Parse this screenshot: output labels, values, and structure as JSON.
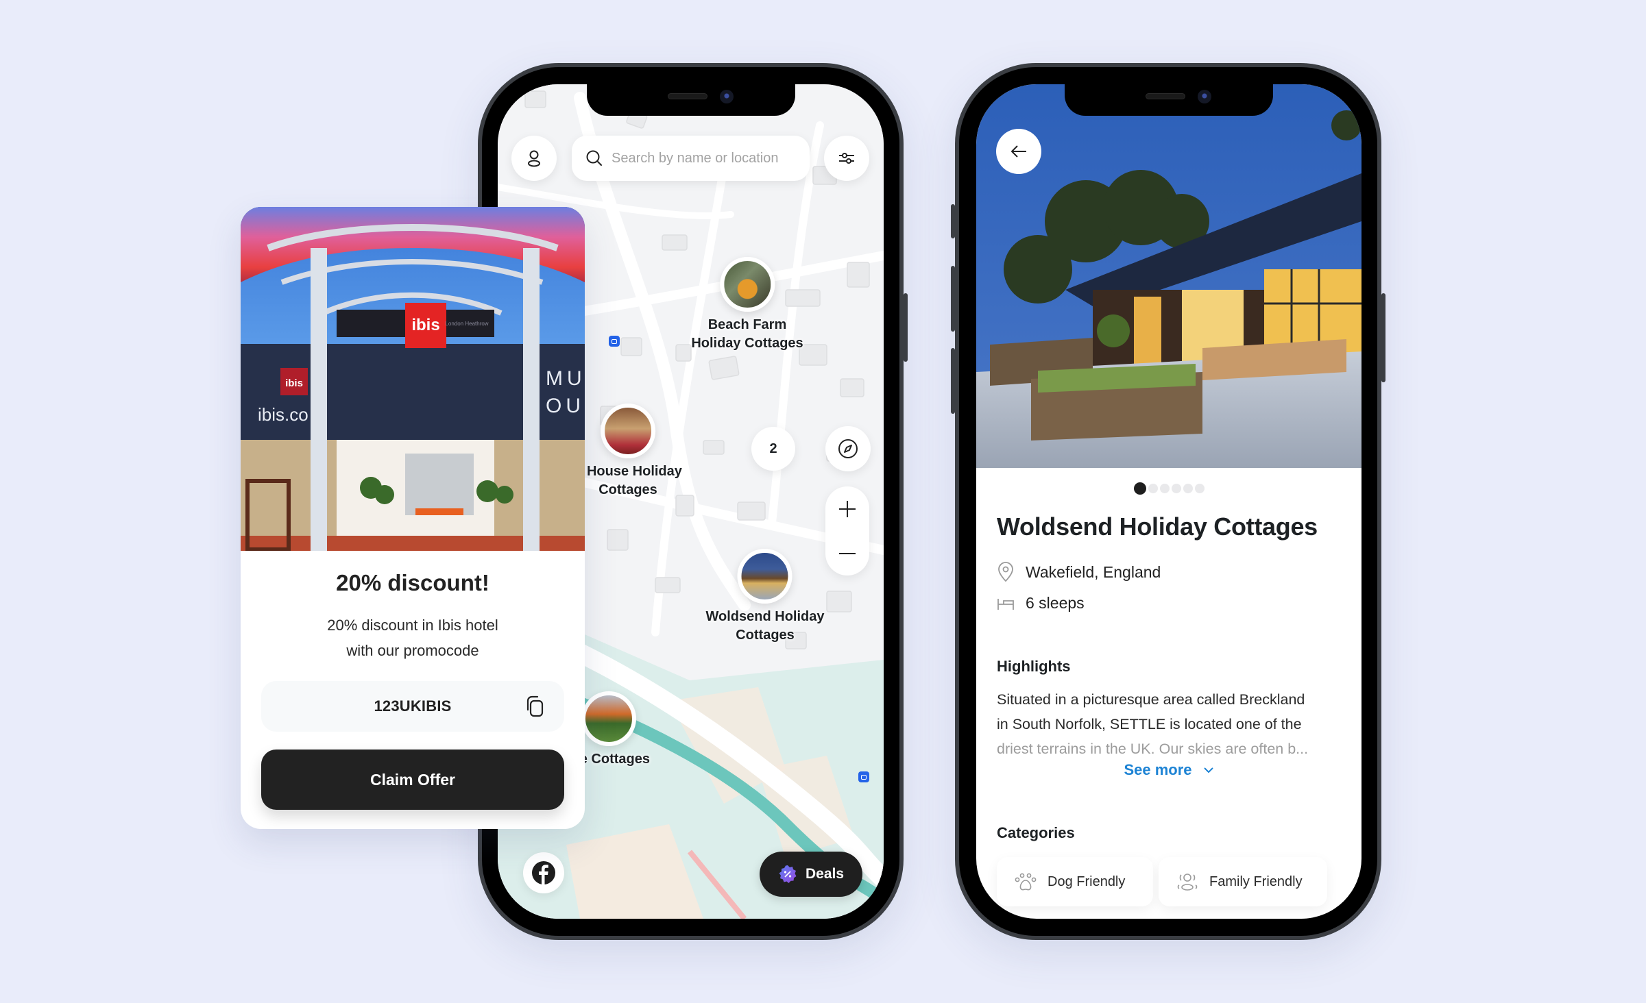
{
  "promo": {
    "title": "20% discount!",
    "description_line1": "20% discount in Ibis hotel",
    "description_line2": "with our promocode",
    "promo_code": "123UKIBIS",
    "claim_label": "Claim Offer",
    "image_signs": {
      "brand": "ibis",
      "brand_sub": "London Heathrow",
      "web": "ibis.co",
      "wall_text_1": "MU",
      "wall_text_2": "OU"
    }
  },
  "map_screen": {
    "search_placeholder": "Search by name or location",
    "pins": [
      {
        "label_line1": "Beach Farm",
        "label_line2": "Holiday Cottages"
      },
      {
        "label_line1": "ff House Holiday",
        "label_line2": "Cottages"
      },
      {
        "label_line1": "Woldsend Holiday",
        "label_line2": "Cottages"
      },
      {
        "label_line1": "ate Cottages",
        "label_line2": ""
      }
    ],
    "cluster_count": "2",
    "deals_label": "Deals",
    "colors": {
      "accent": "#1F1F1F",
      "water": "#6CC6BC",
      "bus": "#2463E8"
    }
  },
  "detail_screen": {
    "carousel": {
      "total": 6,
      "active": 1
    },
    "title": "Woldsend Holiday Cottages",
    "location": "Wakefield, England",
    "sleeps": "6 sleeps",
    "highlights_heading": "Highlights",
    "highlights_line1": "Situated in a picturesque area called Breckland",
    "highlights_line2": "in South Norfolk, SETTLE is located one of the",
    "highlights_line3": "driest terrains in the UK. Our skies are often b...",
    "see_more_label": "See more",
    "categories_heading": "Categories",
    "categories": [
      {
        "label": "Dog Friendly",
        "icon": "paw-icon"
      },
      {
        "label": "Family Friendly",
        "icon": "family-icon"
      }
    ],
    "colors": {
      "link": "#1D83D4"
    }
  }
}
